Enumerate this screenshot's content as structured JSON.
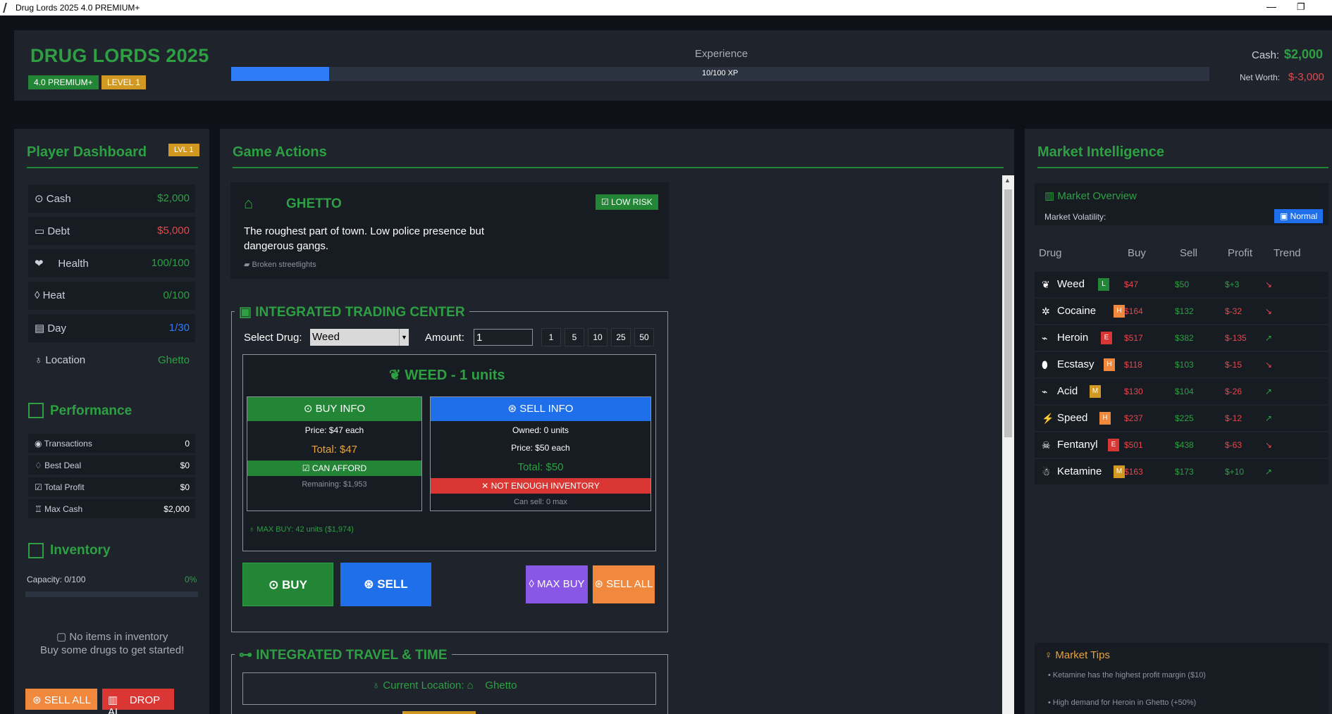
{
  "window": {
    "title": "Drug Lords 2025 4.0 PREMIUM+"
  },
  "header": {
    "title": "DRUG LORDS 2025",
    "version_badge": "4.0 PREMIUM+",
    "level_badge": "LEVEL 1",
    "xp_label": "Experience",
    "xp_text": "10/100 XP",
    "xp_progress": 0.1,
    "cash_label": "Cash:",
    "cash_value": "$2,000",
    "networth_label": "Net Worth:",
    "networth_value": "$-3,000"
  },
  "dashboard": {
    "title": "Player Dashboard",
    "level_badge": "LVL 1",
    "stats": [
      {
        "label": "Cash",
        "value": "$2,000",
        "icon": "money-bag-icon"
      },
      {
        "label": "Debt",
        "value": "$5,000",
        "icon": "credit-card-icon"
      },
      {
        "label": "Health",
        "value": "100/100",
        "icon": "heart-icon"
      },
      {
        "label": "Heat",
        "value": "0/100",
        "icon": "flame-icon"
      },
      {
        "label": "Day",
        "value": "1/30",
        "icon": "calendar-icon"
      },
      {
        "label": "Location",
        "value": "Ghetto",
        "icon": "map-pin-icon"
      }
    ],
    "performance_title": "Performance",
    "performance": [
      {
        "label": "Transactions",
        "value": "0"
      },
      {
        "label": "Best Deal",
        "value": "$0"
      },
      {
        "label": "Total Profit",
        "value": "$0"
      },
      {
        "label": "Max Cash",
        "value": "$2,000"
      }
    ],
    "inventory_title": "Inventory",
    "capacity_label": "Capacity: 0/100",
    "capacity_pct": "0%",
    "empty_line1": "No items in inventory",
    "empty_line2": "Buy some drugs to get started!",
    "sell_all": "SELL ALL",
    "drop_all": "DROP AL"
  },
  "actions": {
    "title": "Game Actions",
    "location": {
      "name": "GHETTO",
      "risk": "LOW RISK",
      "description": "The roughest part of town. Low police presence but dangerous gangs.",
      "feature": "Broken streetlights"
    },
    "trading": {
      "title": "INTEGRATED TRADING CENTER",
      "select_label": "Select Drug:",
      "select_value": "Weed",
      "amount_label": "Amount:",
      "amount_value": "1",
      "quick": [
        "1",
        "5",
        "10",
        "25",
        "50"
      ],
      "selected_title": "WEED - 1 units",
      "buy_info": {
        "header": "BUY INFO",
        "price": "Price: $47 each",
        "total": "Total: $47",
        "status": "CAN AFFORD",
        "remaining": "Remaining: $1,953"
      },
      "sell_info": {
        "header": "SELL INFO",
        "owned": "Owned: 0 units",
        "price": "Price: $50 each",
        "total": "Total: $50",
        "status": "NOT ENOUGH INVENTORY",
        "can_sell": "Can sell: 0 max"
      },
      "max_buy": "MAX BUY: 42 units ($1,974)",
      "buy_btn": "BUY",
      "sell_btn": "SELL",
      "max_buy_btn": "MAX BUY",
      "sell_all_btn": "SELL ALL"
    },
    "travel": {
      "title": "INTEGRATED TRAVEL & TIME",
      "current_label": "Current Location:",
      "current_value": "Ghetto"
    }
  },
  "market": {
    "title": "Market Intelligence",
    "overview_title": "Market Overview",
    "volatility_label": "Market Volatility:",
    "volatility_value": "Normal",
    "columns": [
      "Drug",
      "Buy",
      "Sell",
      "Profit",
      "Trend"
    ],
    "rows": [
      {
        "name": "Weed",
        "risk": "L",
        "risk_color": "#238636",
        "buy": "$47",
        "sell": "$50",
        "profit": "$+3",
        "profit_color": "#2ea043",
        "trend": "↘",
        "trend_color": "#e5484d"
      },
      {
        "name": "Cocaine",
        "risk": "H",
        "risk_color": "#f0883e",
        "buy": "$164",
        "sell": "$132",
        "profit": "$-32",
        "profit_color": "#e5484d",
        "trend": "↘",
        "trend_color": "#e5484d"
      },
      {
        "name": "Heroin",
        "risk": "E",
        "risk_color": "#da3633",
        "buy": "$517",
        "sell": "$382",
        "profit": "$-135",
        "profit_color": "#e5484d",
        "trend": "↗",
        "trend_color": "#2ea043"
      },
      {
        "name": "Ecstasy",
        "risk": "H",
        "risk_color": "#f0883e",
        "buy": "$118",
        "sell": "$103",
        "profit": "$-15",
        "profit_color": "#e5484d",
        "trend": "↘",
        "trend_color": "#e5484d"
      },
      {
        "name": "Acid",
        "risk": "M",
        "risk_color": "#d29922",
        "buy": "$130",
        "sell": "$104",
        "profit": "$-26",
        "profit_color": "#e5484d",
        "trend": "↗",
        "trend_color": "#2ea043"
      },
      {
        "name": "Speed",
        "risk": "H",
        "risk_color": "#f0883e",
        "buy": "$237",
        "sell": "$225",
        "profit": "$-12",
        "profit_color": "#e5484d",
        "trend": "↗",
        "trend_color": "#2ea043"
      },
      {
        "name": "Fentanyl",
        "risk": "E",
        "risk_color": "#da3633",
        "buy": "$501",
        "sell": "$438",
        "profit": "$-63",
        "profit_color": "#e5484d",
        "trend": "↘",
        "trend_color": "#e5484d"
      },
      {
        "name": "Ketamine",
        "risk": "M",
        "risk_color": "#d29922",
        "buy": "$163",
        "sell": "$173",
        "profit": "$+10",
        "profit_color": "#2ea043",
        "trend": "↗",
        "trend_color": "#2ea043"
      }
    ],
    "tips_title": "Market Tips",
    "tips": [
      "• Ketamine has the highest profit margin ($10)",
      "• High demand for Heroin in Ghetto (+50%)"
    ]
  }
}
